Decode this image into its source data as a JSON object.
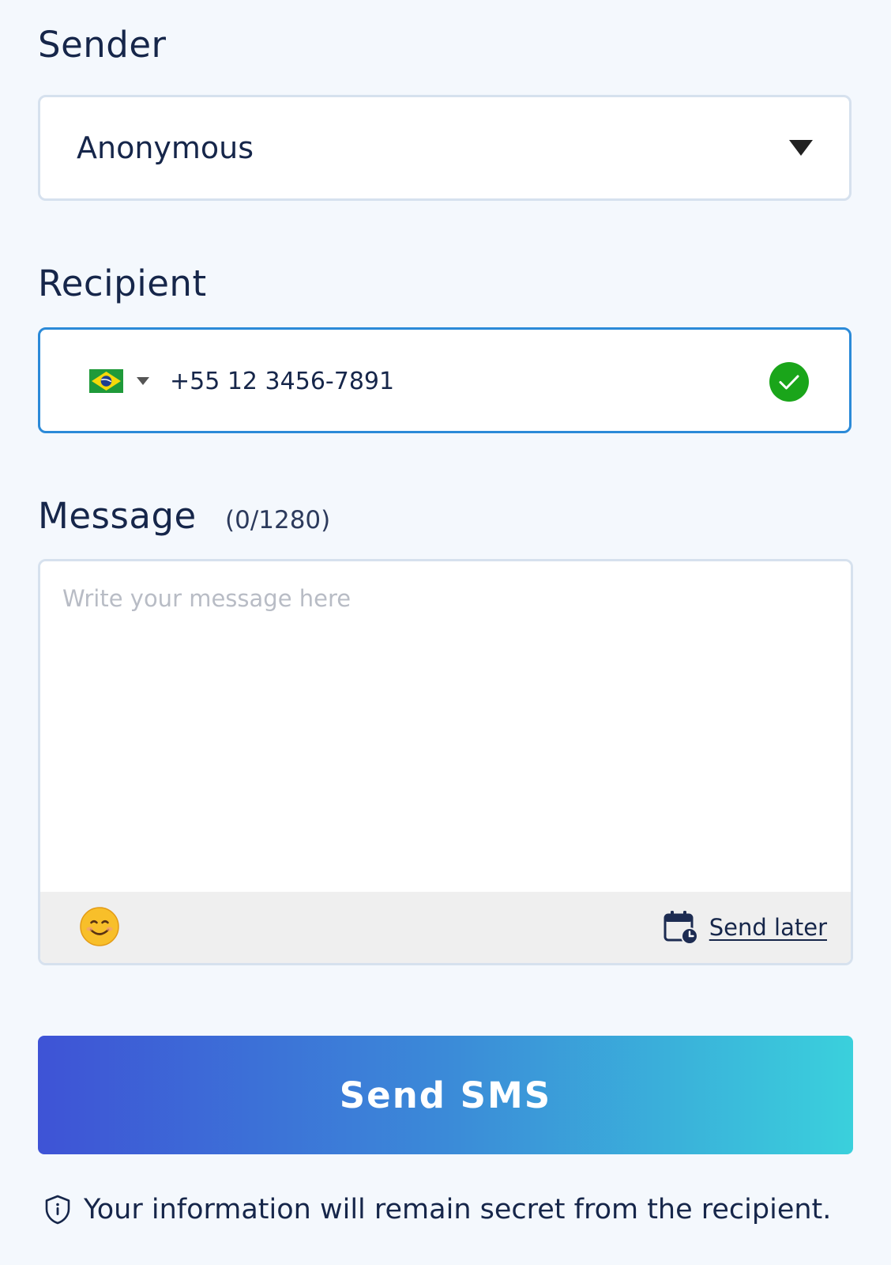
{
  "sender": {
    "label": "Sender",
    "selected": "Anonymous",
    "icon": "caret-down-icon"
  },
  "recipient": {
    "label": "Recipient",
    "country": "Brazil",
    "country_icon": "brazil-flag-icon",
    "phone_value": "+55 12 3456-7891",
    "valid_icon": "check-circle-icon",
    "valid_color": "#1aa51a"
  },
  "message": {
    "label": "Message",
    "counter": "(0/1280)",
    "placeholder": "Write your message here",
    "value": "",
    "emoji_icon": "smiley-emoji-icon",
    "send_later_label": "Send later",
    "send_later_icon": "calendar-clock-icon"
  },
  "submit": {
    "label": "Send SMS",
    "gradient": [
      "#3e53d6",
      "#3ad0dc"
    ]
  },
  "privacy_notice": {
    "text": "Your information will remain secret from the recipient.",
    "icon": "shield-info-icon"
  }
}
